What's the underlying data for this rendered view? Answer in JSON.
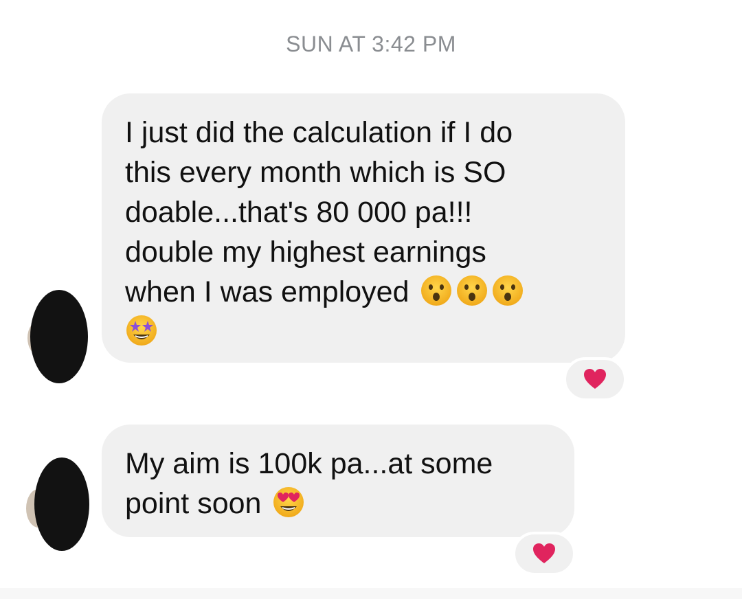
{
  "thread": {
    "timestamp": "SUN AT 3:42 PM"
  },
  "messages": [
    {
      "id": "msg-1",
      "lines": [
        "I just did the calculation if I do",
        "this every month which is SO",
        "doable...that's 80 000 pa!!!",
        "double my highest earnings",
        "when I was employed"
      ],
      "emoji": [
        "astonished-face",
        "astonished-face",
        "astonished-face",
        "star-struck-face"
      ],
      "reaction": "heart-icon"
    },
    {
      "id": "msg-2",
      "lines": [
        "My aim is 100k pa...at some",
        "point soon"
      ],
      "emoji": [
        "heart-eyes-face"
      ],
      "reaction": "heart-icon"
    }
  ],
  "colors": {
    "bubble": "#f0f0f0",
    "timestamp": "#8a8d91",
    "text": "#111111",
    "heart": "#e0245e",
    "emoji_face": "#f5b51e",
    "star": "#8a4fd8"
  }
}
